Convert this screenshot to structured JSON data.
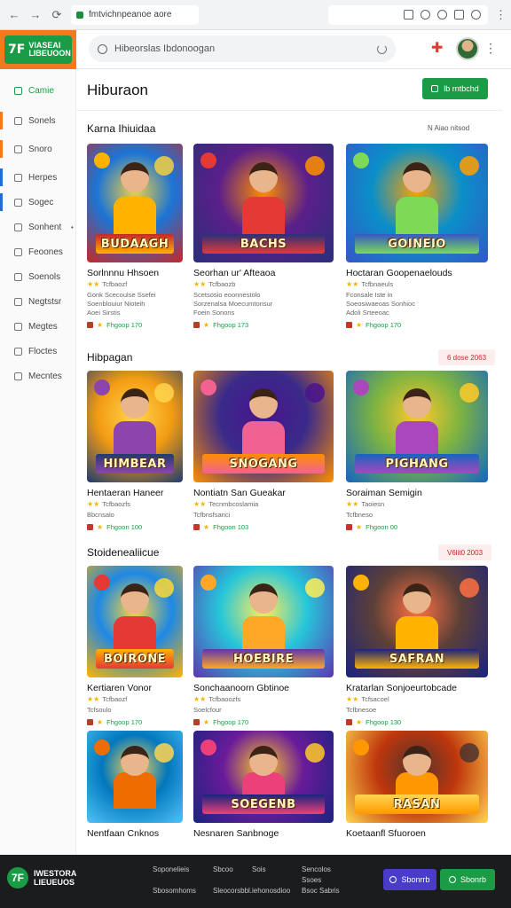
{
  "browser": {
    "url": "fmtvichnpeanoe aore",
    "back_icon": "←",
    "forward_icon": "→",
    "reload_icon": "⟳",
    "more_icon": "⋮"
  },
  "header": {
    "logo_mark": "7F",
    "logo_text_1": "VIASEAI",
    "logo_text_2": "LIBEUOON",
    "search_placeholder": "Hibeorslas Ibdonoogan",
    "puzzle_icon": "✚",
    "more_icon": "⋮"
  },
  "sidebar": {
    "items": [
      {
        "label": "Camie",
        "icon": "home-icon"
      },
      {
        "label": "Sonels",
        "icon": "grid-icon"
      },
      {
        "label": "Snoro",
        "icon": "store-icon"
      },
      {
        "label": "Herpes",
        "icon": "heart-icon"
      },
      {
        "label": "Sogec",
        "icon": "tag-icon"
      },
      {
        "label": "Sonhent",
        "icon": "list-icon",
        "badge": "•"
      },
      {
        "label": "Feoones",
        "icon": "phone-icon"
      },
      {
        "label": "Soenols",
        "icon": "chart-icon"
      },
      {
        "label": "Negtstsr",
        "icon": "gift-icon"
      },
      {
        "label": "Megtes",
        "icon": "chat-icon"
      },
      {
        "label": "Floctes",
        "icon": "clock-icon"
      },
      {
        "label": "Mecntes",
        "icon": "settings-icon"
      }
    ]
  },
  "main": {
    "title": "Hiburaon",
    "primary_button": "lb rntbchd",
    "sections": [
      {
        "title": "Karna Ihiuidaa",
        "link": "N Aiao nitsod",
        "cards": [
          {
            "title": "Sorlnnnu Hhsoen",
            "sub1": "Tcfbaozf",
            "sub2": "Gonk Scecoulse Ssefei",
            "sub3": "Soenblouiur Nioteih",
            "sub4": "Aoei Sirstis",
            "meta": "Fhgoop 170",
            "banner": "BUDAAGH"
          },
          {
            "title": "Seorhan ur' Afteaoa",
            "sub1": "Tcfbaozb",
            "sub2": "Scetsosio eoonnestolo",
            "sub3": "Sorzenalsa Moecumtonsur",
            "sub4": "Foein Sonons",
            "meta": "Fhgoop 173",
            "banner": "BACHS"
          },
          {
            "title": "Hoctaran Goopenaelouds",
            "sub1": "Tcfbnaeuls",
            "sub2": "Fconsale Iste in",
            "sub3": "Soeosiwaeoas Sonhioc",
            "sub4": "Adoli Srteeoac",
            "meta": "Fhgoop 170",
            "banner": "GOINEIO"
          }
        ]
      },
      {
        "title": "Hibpagan",
        "pill": "6 dose 2063",
        "cards": [
          {
            "title": "Hentaeran Haneer",
            "sub1": "Tcfbaozfs",
            "sub2": "Bbcnsalo",
            "meta": "Fhgoon 100",
            "banner": "HIMBEAR"
          },
          {
            "title": "Nontiatn San Gueakar",
            "sub1": "Tecnmbcoslamia",
            "sub2": "Tcfbnsfsanci",
            "meta": "Fhgoon 103",
            "banner": "SNOGANG"
          },
          {
            "title": "Soraiman Semigin",
            "sub1": "Taoiesn",
            "sub2": "Tcfbneso",
            "meta": "Fhgoon 00",
            "banner": "PIGHANG"
          }
        ]
      },
      {
        "title": "Stoidenealiicue",
        "pill": "V6lit0 2003",
        "cards": [
          {
            "title": "Kertiaren Vonor",
            "sub1": "Tcfbaozf",
            "sub2": "Tcfsoulo",
            "meta": "Fhgoop 170",
            "banner": "BOIRONE"
          },
          {
            "title": "Sonchaanoorn Gbtinoe",
            "sub1": "Tcfbaoozfs",
            "sub2": "Soelcfour",
            "meta": "Fhgoop 170",
            "banner": "HOEBIRE"
          },
          {
            "title": "Kratarlan Sonjoeurtobcade",
            "sub1": "Tcfsacoel",
            "sub2": "Tcfbnesoe",
            "meta": "Fhgoop 130",
            "banner": "SAFRAN"
          }
        ]
      },
      {
        "cards": [
          {
            "title": "Nentfaan Cnknos",
            "banner": ""
          },
          {
            "title": "Nesnaren Sanbnoge",
            "banner": "SOEGENB"
          },
          {
            "title": "Koetaanfl Sfuoroen",
            "banner": "RASAN"
          }
        ]
      }
    ]
  },
  "footer": {
    "logo_mark": "7F",
    "logo_text_1": "IWESTORA",
    "logo_text_2": "LIEUEUOS",
    "links": [
      "Soponelieis",
      "Sbcoo",
      "Sois",
      "Sencolos",
      "Sbosomhoms",
      "Sleocorsbbl.iehonosdioo",
      "Bsoc Sabris",
      "Ssoes"
    ],
    "button_1": "Sbonrrb",
    "button_2": "Sbonrb",
    "button_1_color": "#4a3cc8",
    "button_2_color": "#1a9b45"
  }
}
